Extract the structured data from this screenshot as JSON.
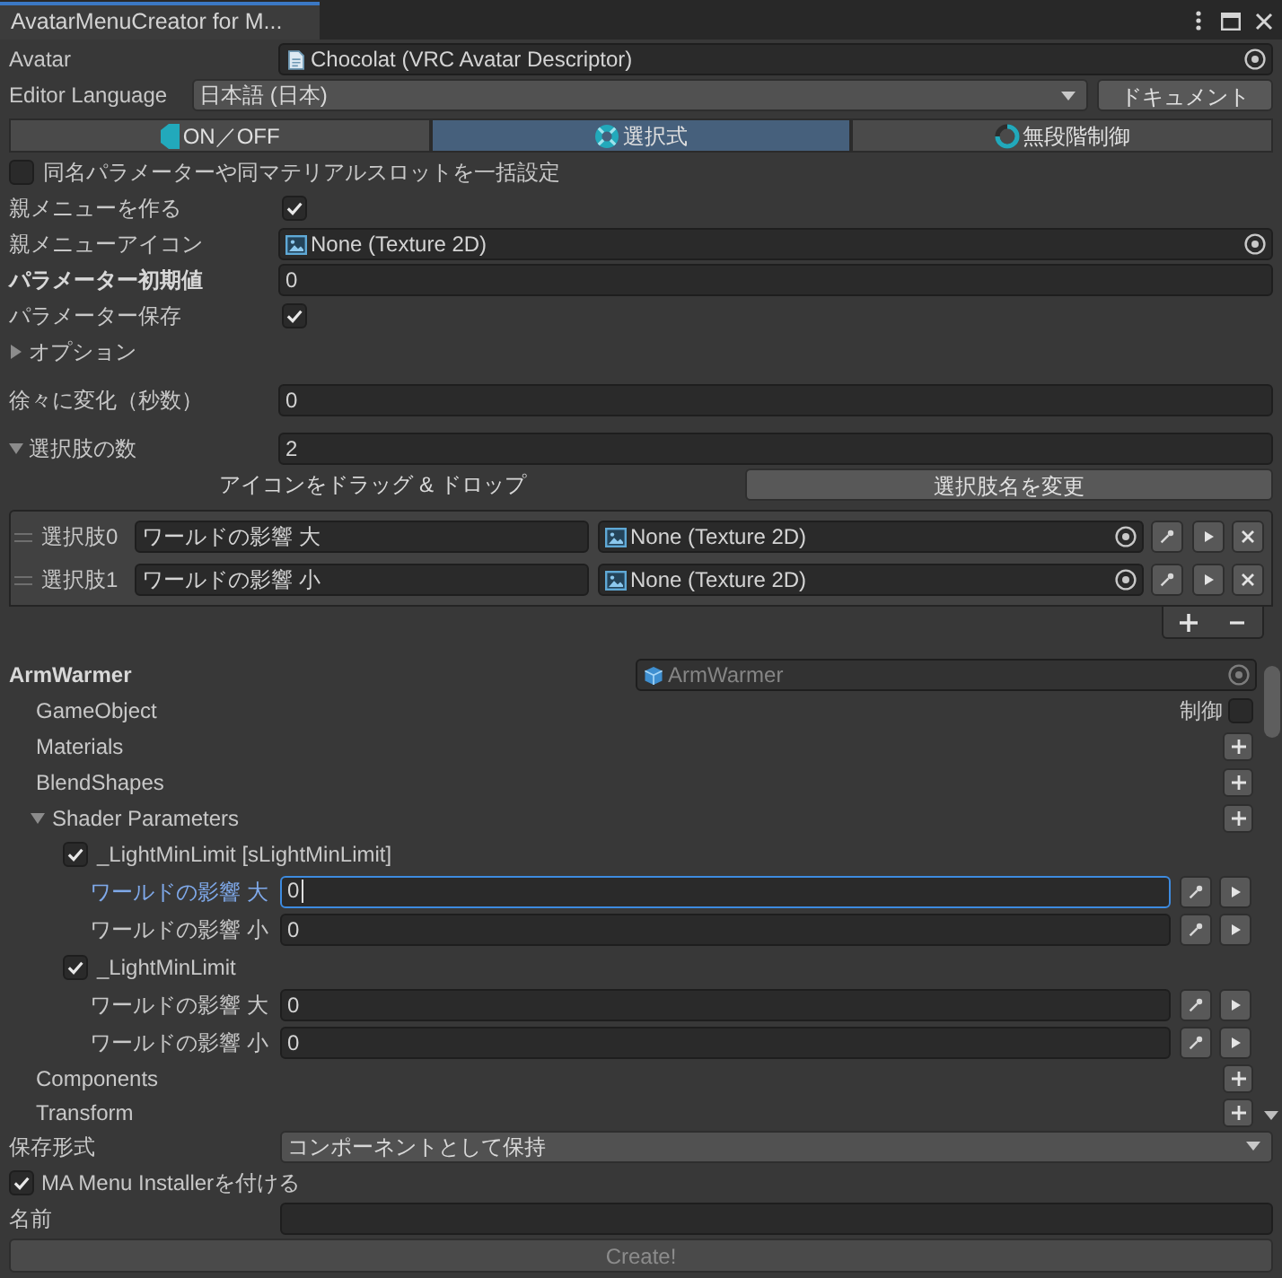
{
  "window": {
    "tab_title": "AvatarMenuCreator for M..."
  },
  "avatar": {
    "label": "Avatar",
    "value": "Chocolat (VRC Avatar Descriptor)"
  },
  "editor_language": {
    "label": "Editor Language",
    "value": "日本語 (日本)",
    "button": "ドキュメント"
  },
  "mode_tabs": [
    {
      "kind": "toggle",
      "label": "ON／OFF",
      "selected": false
    },
    {
      "kind": "choice",
      "label": "選択式",
      "selected": true
    },
    {
      "kind": "radial",
      "label": "無段階制御",
      "selected": false
    }
  ],
  "bulk_setting": {
    "label": "同名パラメーターや同マテリアルスロットを一括設定",
    "checked": false
  },
  "settings": [
    {
      "kind": "checkbox",
      "label": "親メニューを作る",
      "checked": true
    },
    {
      "kind": "object",
      "label": "親メニューアイコン",
      "value": "None (Texture 2D)"
    },
    {
      "kind": "field",
      "label": "パラメーター初期値",
      "value": "0",
      "bold": true
    },
    {
      "kind": "checkbox",
      "label": "パラメーター保存",
      "checked": true
    },
    {
      "kind": "foldout",
      "label": "オプション",
      "expanded": false
    },
    {
      "kind": "field",
      "label": "徐々に変化（秒数）",
      "value": "0"
    },
    {
      "kind": "foldout",
      "label": "選択肢の数",
      "expanded": true,
      "value": "2"
    }
  ],
  "choice_tools": [
    {
      "kind": "drop_area",
      "label": "アイコンをドラッグ & ドロップ"
    },
    {
      "kind": "button",
      "label": "選択肢名を変更"
    }
  ],
  "choices": [
    {
      "label": "選択肢0",
      "name": "ワールドの影響 大",
      "icon": "None (Texture 2D)"
    },
    {
      "label": "選択肢1",
      "name": "ワールドの影響 小",
      "icon": "None (Texture 2D)"
    }
  ],
  "target": {
    "label": "ArmWarmer",
    "object": "ArmWarmer",
    "disabled": true
  },
  "target_sections": [
    {
      "kind": "toggle",
      "label": "GameObject",
      "toggle_label": "制御",
      "checked": false
    },
    {
      "kind": "add",
      "label": "Materials"
    },
    {
      "kind": "add",
      "label": "BlendShapes"
    },
    {
      "kind": "group",
      "label": "Shader Parameters",
      "expanded": true,
      "children": [
        {
          "label": "_LightMinLimit [sLightMinLimit]",
          "checked": true,
          "values": [
            {
              "label": "ワールドの影響 大",
              "value": "0",
              "focused": true
            },
            {
              "label": "ワールドの影響 小",
              "value": "0",
              "focused": false
            }
          ]
        },
        {
          "label": "_LightMinLimit",
          "checked": true,
          "values": [
            {
              "label": "ワールドの影響 大",
              "value": "0",
              "focused": false
            },
            {
              "label": "ワールドの影響 小",
              "value": "0",
              "focused": false
            }
          ]
        }
      ]
    },
    {
      "kind": "add",
      "label": "Components"
    },
    {
      "kind": "add",
      "label": "Transform"
    }
  ],
  "save_format": {
    "label": "保存形式",
    "value": "コンポーネントとして保持"
  },
  "menu_installer": {
    "label": "MA Menu Installerを付ける",
    "checked": true
  },
  "name_field": {
    "label": "名前"
  },
  "create_button": {
    "label": "Create!",
    "disabled": true
  }
}
